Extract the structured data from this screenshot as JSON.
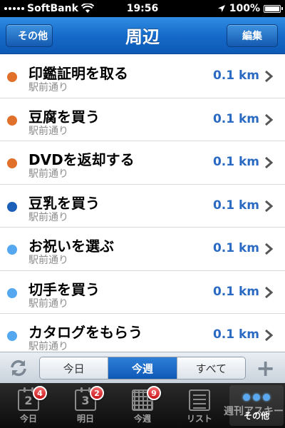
{
  "statusbar": {
    "carrier": "SoftBank",
    "time": "19:56",
    "battery": "100%"
  },
  "navbar": {
    "title": "周辺",
    "back_label": "その他",
    "edit_label": "編集"
  },
  "items": [
    {
      "title": "印鑑証明を取る",
      "subtitle": "駅前通り",
      "distance": "0.1 km",
      "color": "#e0702a"
    },
    {
      "title": "豆腐を買う",
      "subtitle": "駅前通り",
      "distance": "0.1 km",
      "color": "#e0702a"
    },
    {
      "title": "DVDを返却する",
      "subtitle": "駅前通り",
      "distance": "0.1 km",
      "color": "#e0702a"
    },
    {
      "title": "豆乳を買う",
      "subtitle": "駅前通り",
      "distance": "0.1 km",
      "color": "#1c5fb8"
    },
    {
      "title": "お祝いを選ぶ",
      "subtitle": "駅前通り",
      "distance": "0.1 km",
      "color": "#55a8f0"
    },
    {
      "title": "切手を買う",
      "subtitle": "駅前通り",
      "distance": "0.1 km",
      "color": "#55a8f0"
    },
    {
      "title": "カタログをもらう",
      "subtitle": "駅前通り",
      "distance": "0.1 km",
      "color": "#55a8f0"
    }
  ],
  "segments": {
    "today": "今日",
    "this_week": "今週",
    "all": "すべて",
    "selected": "今週"
  },
  "tabs": [
    {
      "label": "今日",
      "icon": "calendar-icon",
      "number": "2",
      "badge": "4"
    },
    {
      "label": "明日",
      "icon": "calendar-icon",
      "number": "3",
      "badge": "2"
    },
    {
      "label": "今週",
      "icon": "calendar-grid-icon",
      "badge": "9"
    },
    {
      "label": "リスト",
      "icon": "list-icon"
    },
    {
      "label": "その他",
      "icon": "more-dots-icon",
      "selected": true
    }
  ],
  "watermark": "週刊アスキー"
}
